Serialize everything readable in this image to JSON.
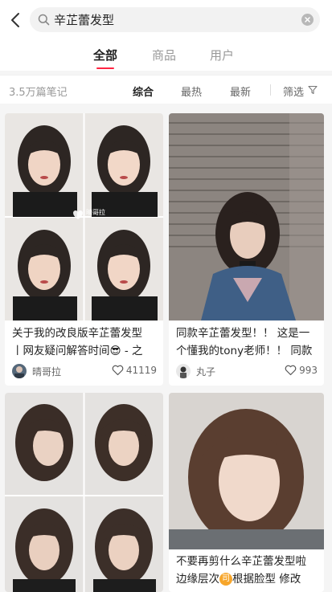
{
  "search": {
    "query": "辛芷蕾发型"
  },
  "tabs": [
    {
      "label": "全部",
      "active": true
    },
    {
      "label": "商品",
      "active": false
    },
    {
      "label": "用户",
      "active": false
    }
  ],
  "filters": {
    "count": "3.5万篇笔记",
    "options": [
      "综合",
      "最热",
      "最新"
    ],
    "filter_label": "筛选"
  },
  "notes": [
    {
      "title_line1": "关于我的改良版辛芷蕾发型",
      "title_line2": "丨网友疑问解答时间😎 - 之",
      "author": "晴哥拉",
      "likes": "41119",
      "watermark": "晴哥拉"
    },
    {
      "title_line1": "同款辛芷蕾发型！！ 这是一",
      "title_line2": "个懂我的tony老师！！ 同款",
      "author": "丸子",
      "likes": "993"
    },
    {
      "title_line1": "",
      "title_line2": ""
    },
    {
      "title_line1": "不要再剪什么辛芷蕾发型啦",
      "title_line2_a": "边缘层次",
      "title_line2_icon": "司",
      "title_line2_b": "根据脸型 修改"
    }
  ],
  "colors": {
    "accent": "#ff2442",
    "background": "#f5f5f5"
  },
  "icons": [
    "back-icon",
    "search-icon",
    "clear-icon",
    "funnel-icon",
    "heart-icon"
  ]
}
